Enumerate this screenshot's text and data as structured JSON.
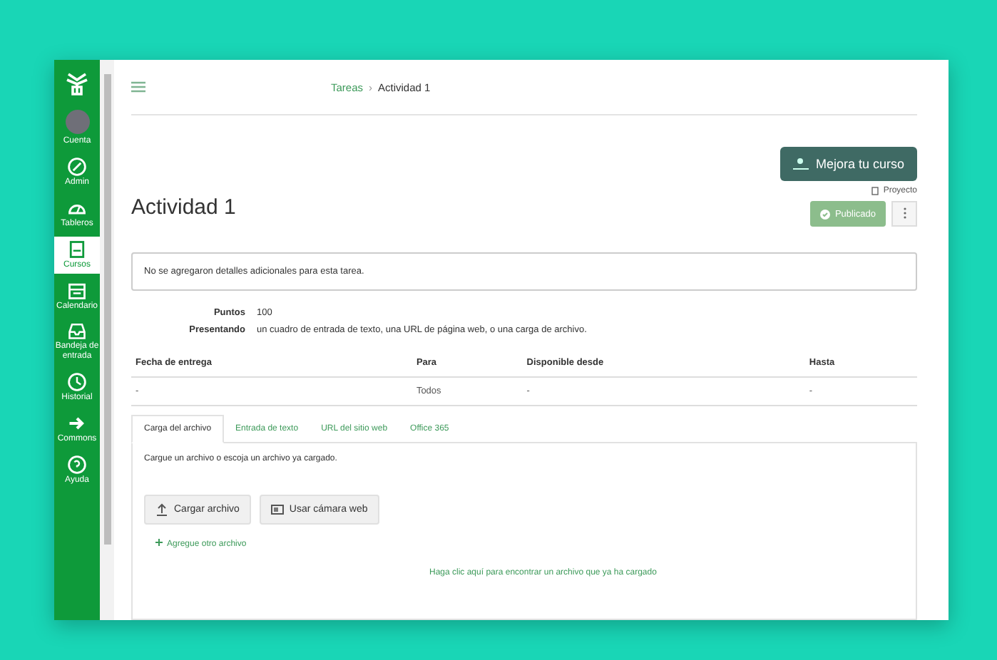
{
  "sidebar": {
    "items": [
      {
        "kind": "avatar",
        "label": "Cuenta",
        "selected": false
      },
      {
        "kind": "admin",
        "label": "Admin",
        "selected": false
      },
      {
        "kind": "dashboard",
        "label": "Tableros",
        "selected": false
      },
      {
        "kind": "courses",
        "label": "Cursos",
        "selected": true
      },
      {
        "kind": "calendar",
        "label": "Calendario",
        "selected": false
      },
      {
        "kind": "inbox",
        "label": "Bandeja de entrada",
        "selected": false
      },
      {
        "kind": "history",
        "label": "Historial",
        "selected": false
      },
      {
        "kind": "commons",
        "label": "Commons",
        "selected": false
      },
      {
        "kind": "help",
        "label": "Ayuda",
        "selected": false
      }
    ]
  },
  "breadcrumb": [
    "Tareas",
    "Actividad 1"
  ],
  "breadcrumb_separator": "›",
  "title": "Actividad 1",
  "improve_button": "Mejora tu curso",
  "project_label": "Proyecto",
  "publish_button": {
    "label": "Publicado",
    "published": true
  },
  "description": "No se agregaron detalles adicionales para esta tarea.",
  "details": [
    {
      "label": "Puntos",
      "value": "100"
    },
    {
      "label": "Presentando",
      "value": "un cuadro de entrada de texto, una URL de página web, o una carga de archivo."
    }
  ],
  "table": {
    "columns": [
      "Fecha de entrega",
      "Para",
      "Disponible desde",
      "Hasta"
    ],
    "rows": [
      [
        "-",
        "Todos",
        "-",
        "-"
      ]
    ]
  },
  "tabs": [
    {
      "label": "Carga del archivo",
      "selected": true
    },
    {
      "label": "Entrada de texto",
      "selected": false
    },
    {
      "label": "URL del sitio web",
      "selected": false
    },
    {
      "label": "Office 365",
      "selected": false
    }
  ],
  "upload": {
    "instructions": "Cargue un archivo o escoja un archivo ya cargado.",
    "buttons": [
      {
        "kind": "upload",
        "label": "Cargar archivo"
      },
      {
        "kind": "webcam",
        "label": "Usar cámara web"
      }
    ],
    "add_link": "Agregue otro archivo",
    "find_link": "Haga clic aquí para encontrar un archivo que ya ha cargado"
  }
}
